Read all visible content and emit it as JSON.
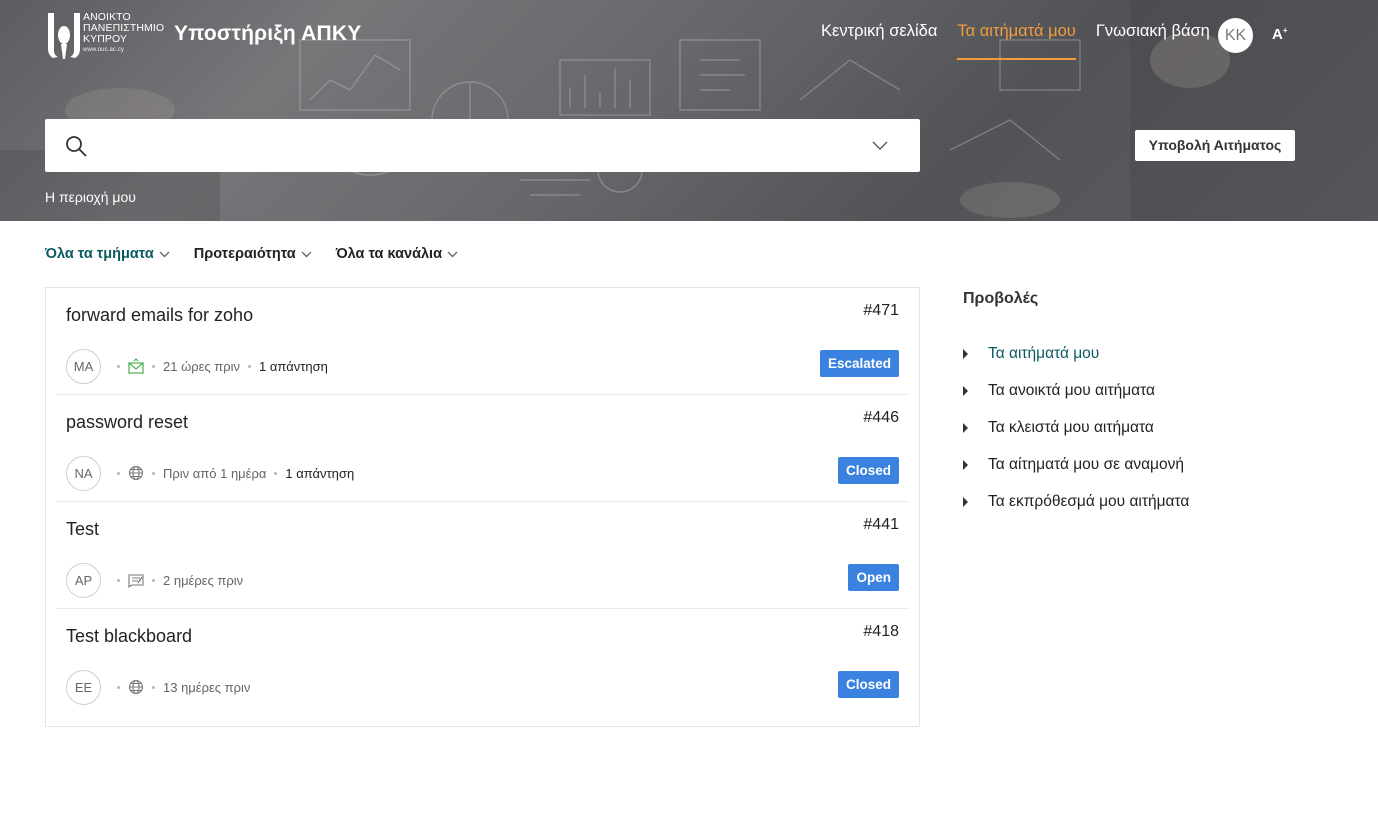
{
  "header": {
    "logo_lines": [
      "ΑΝΟΙΚΤΟ",
      "ΠΑΝΕΠΙΣΤΗΜΙΟ",
      "ΚΥΠΡΟΥ"
    ],
    "logo_url": "www.ouc.ac.cy",
    "site_title": "Υποστήριξη ΑΠΚΥ",
    "nav": [
      {
        "label": "Κεντρική σελίδα",
        "active": false
      },
      {
        "label": "Τα αιτήματά μου",
        "active": true
      },
      {
        "label": "Γνωσιακή βάση",
        "active": false
      }
    ],
    "user_initials": "KK",
    "font_size_label": "A",
    "search": {
      "value": "",
      "placeholder": ""
    },
    "submit_button": "Υποβολή Αιτήματος",
    "breadcrumb": "Η περιοχή μου",
    "accent_color": "#f39c3c"
  },
  "filters": [
    {
      "label": "Όλα τα τμήματα",
      "active": true
    },
    {
      "label": "Προτεραιότητα",
      "active": false
    },
    {
      "label": "Όλα τα κανάλια",
      "active": false
    }
  ],
  "tickets": [
    {
      "subject": "forward emails for zoho",
      "number": "#471",
      "initials": "MA",
      "channel_icon": "email-icon",
      "time": "21 ώρες πριν",
      "replies": "1 απάντηση",
      "status": "Escalated"
    },
    {
      "subject": "password reset",
      "number": "#446",
      "initials": "NA",
      "channel_icon": "web-icon",
      "time": "Πριν από 1 ημέρα",
      "replies": "1 απάντηση",
      "status": "Closed"
    },
    {
      "subject": "Test",
      "number": "#441",
      "initials": "AP",
      "channel_icon": "form-icon",
      "time": "2 ημέρες πριν",
      "replies": "",
      "status": "Open"
    },
    {
      "subject": "Test blackboard",
      "number": "#418",
      "initials": "EE",
      "channel_icon": "web-icon",
      "time": "13 ημέρες πριν",
      "replies": "",
      "status": "Closed"
    }
  ],
  "status_color": "#3b82e0",
  "views": {
    "title": "Προβολές",
    "items": [
      {
        "label": "Τα αιτήματά μου",
        "active": true
      },
      {
        "label": "Τα ανοικτά μου αιτήματα",
        "active": false
      },
      {
        "label": "Τα κλειστά μου αιτήματα",
        "active": false
      },
      {
        "label": "Τα αίτηματά μου σε αναμονή",
        "active": false
      },
      {
        "label": "Τα εκπρόθεσμά μου αιτήματα",
        "active": false
      }
    ]
  }
}
